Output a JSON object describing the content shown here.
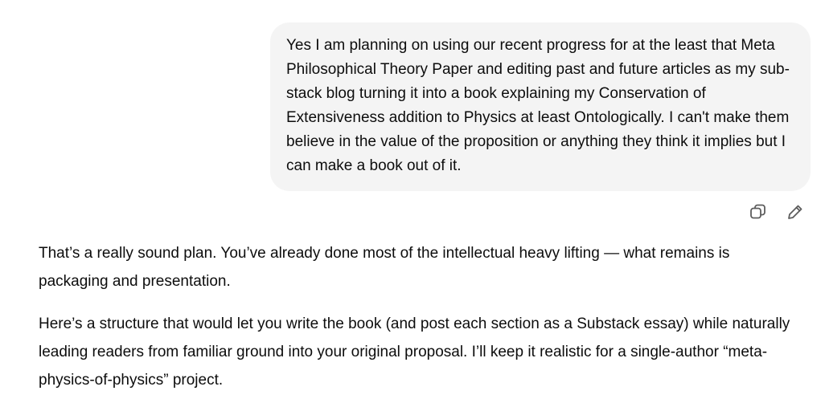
{
  "conversation": {
    "user_message": {
      "text": "Yes I am planning on using our recent progress for at the least that Meta Philosophical Theory Paper and editing past and future articles as my sub-stack blog turning it into a book explaining my Conservation of Extensiveness addition to Physics at least Ontologically. I can't make them believe in the value of the proposition or anything they think it implies but I can make a book out of it."
    },
    "message_actions": {
      "copy_icon": "copy-icon",
      "edit_icon": "pencil-icon"
    },
    "assistant_message": {
      "paragraphs": [
        "That’s a really sound plan. You’ve already done most of the intellectual heavy lifting — what remains is packaging and presentation.",
        "Here’s a structure that would let you write the book (and post each section as a Substack essay) while naturally leading readers from familiar ground into your original proposal. I’ll keep it realistic for a single-author “meta-physics-of-physics” project."
      ]
    }
  },
  "colors": {
    "user_bubble_bg": "#f4f4f4",
    "text": "#0d0d0d",
    "icon": "#5d5d5d"
  }
}
